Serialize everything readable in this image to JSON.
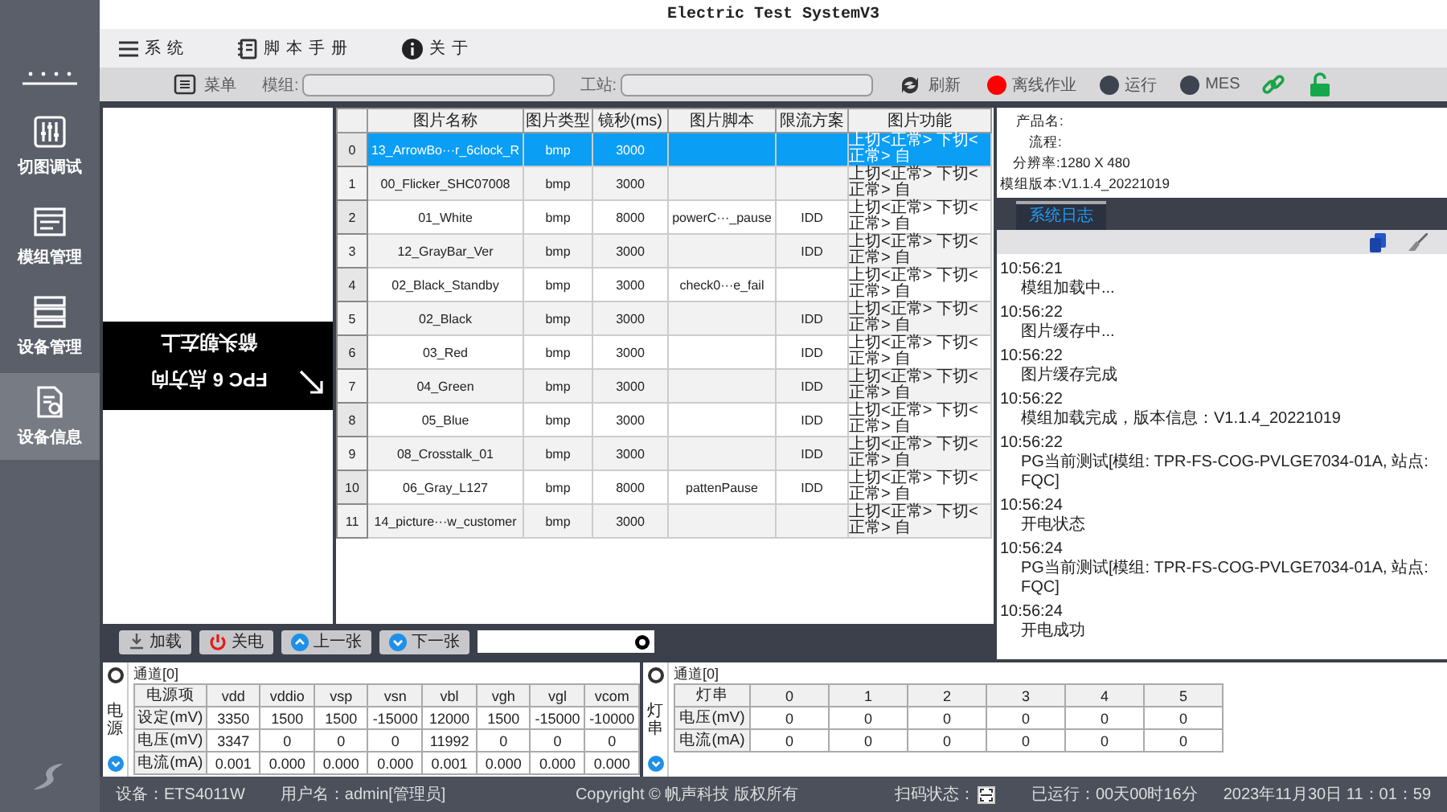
{
  "sidebar": {
    "items": [
      {
        "label": "切图调试",
        "selected": false
      },
      {
        "label": "模组管理",
        "selected": false
      },
      {
        "label": "设备管理",
        "selected": false
      },
      {
        "label": "设备信息",
        "selected": true
      }
    ]
  },
  "window": {
    "title": "Electric Test SystemV3"
  },
  "menu": [
    "系统",
    "脚本手册",
    "关于"
  ],
  "toolbar": {
    "menu_button": "菜单",
    "module_label": "模组:",
    "station_label": "工站:",
    "refresh": "刷新",
    "statuses": [
      {
        "label": "离线作业",
        "color": "#ff0000"
      },
      {
        "label": "运行",
        "color": "#3d4450"
      },
      {
        "label": "MES",
        "color": "#3d4450"
      }
    ]
  },
  "preview": {
    "lines": [
      "箭头朝左上",
      "FPC 6 点方向"
    ]
  },
  "table": {
    "columns": [
      "图片名称",
      "图片类型",
      "镜秒(ms)",
      "图片脚本",
      "限流方案",
      "图片功能"
    ],
    "rows": [
      {
        "index": "0",
        "cells": [
          "13_ArrowBo···r_6clock_R",
          "bmp",
          "3000",
          "",
          "",
          "上切<正常> 下切<正常> 自"
        ],
        "selected": true
      },
      {
        "index": "1",
        "cells": [
          "00_Flicker_SHC07008",
          "bmp",
          "3000",
          "",
          "",
          "上切<正常> 下切<正常> 自"
        ],
        "selected": false
      },
      {
        "index": "2",
        "cells": [
          "01_White",
          "bmp",
          "8000",
          "powerC···_pause",
          "IDD",
          "上切<正常> 下切<正常> 自"
        ],
        "selected": false
      },
      {
        "index": "3",
        "cells": [
          "12_GrayBar_Ver",
          "bmp",
          "3000",
          "",
          "IDD",
          "上切<正常> 下切<正常> 自"
        ],
        "selected": false
      },
      {
        "index": "4",
        "cells": [
          "02_Black_Standby",
          "bmp",
          "3000",
          "check0···e_fail",
          "",
          "上切<正常> 下切<正常> 自"
        ],
        "selected": false
      },
      {
        "index": "5",
        "cells": [
          "02_Black",
          "bmp",
          "3000",
          "",
          "IDD",
          "上切<正常> 下切<正常> 自"
        ],
        "selected": false
      },
      {
        "index": "6",
        "cells": [
          "03_Red",
          "bmp",
          "3000",
          "",
          "IDD",
          "上切<正常> 下切<正常> 自"
        ],
        "selected": false
      },
      {
        "index": "7",
        "cells": [
          "04_Green",
          "bmp",
          "3000",
          "",
          "IDD",
          "上切<正常> 下切<正常> 自"
        ],
        "selected": false
      },
      {
        "index": "8",
        "cells": [
          "05_Blue",
          "bmp",
          "3000",
          "",
          "IDD",
          "上切<正常> 下切<正常> 自"
        ],
        "selected": false
      },
      {
        "index": "9",
        "cells": [
          "08_Crosstalk_01",
          "bmp",
          "3000",
          "",
          "IDD",
          "上切<正常> 下切<正常> 自"
        ],
        "selected": false
      },
      {
        "index": "10",
        "cells": [
          "06_Gray_L127",
          "bmp",
          "8000",
          "pattenPause",
          "IDD",
          "上切<正常> 下切<正常> 自"
        ],
        "selected": false
      },
      {
        "index": "11",
        "cells": [
          "14_picture···w_customer",
          "bmp",
          "3000",
          "",
          "",
          "上切<正常> 下切<正常> 自"
        ],
        "selected": false
      }
    ]
  },
  "controls": {
    "buttons": [
      {
        "label": "加载",
        "kind": "load"
      },
      {
        "label": "关电",
        "kind": "power"
      },
      {
        "label": "上一张",
        "kind": "up"
      },
      {
        "label": "下一张",
        "kind": "down"
      }
    ]
  },
  "info": [
    "产品名:",
    "流程:",
    "分辨率:1280 X 480",
    "模组版本:V1.1.4_20221019"
  ],
  "log": {
    "tabs": [
      {
        "label": "系统日志",
        "selected": true
      }
    ],
    "entries": [
      {
        "time": "10:56:21",
        "message": "模组加载中..."
      },
      {
        "time": "10:56:22",
        "message": "图片缓存中..."
      },
      {
        "time": "10:56:22",
        "message": "图片缓存完成"
      },
      {
        "time": "10:56:22",
        "message": "模组加载完成，版本信息：V1.1.4_20221019"
      },
      {
        "time": "10:56:22",
        "message": "PG当前测试[模组: TPR-FS-COG-PVLGE7034-01A, 站点: FQC]"
      },
      {
        "time": "10:56:24",
        "message": "开电状态"
      },
      {
        "time": "10:56:24",
        "message": "PG当前测试[模组: TPR-FS-COG-PVLGE7034-01A, 站点: FQC]"
      },
      {
        "time": "10:56:24",
        "message": "开电成功"
      }
    ]
  },
  "power": {
    "label": "电源",
    "channel": "通道[0]",
    "columns": [
      "电源项",
      "vdd",
      "vddio",
      "vsp",
      "vsn",
      "vbl",
      "vgh",
      "vgl",
      "vcom"
    ],
    "rows": [
      [
        "设定(mV)",
        "3350",
        "1500",
        "1500",
        "-15000",
        "12000",
        "1500",
        "-15000",
        "-10000"
      ],
      [
        "电压(mV)",
        "3347",
        "0",
        "0",
        "0",
        "11992",
        "0",
        "0",
        "0"
      ],
      [
        "电流(mA)",
        "0.001",
        "0.000",
        "0.000",
        "0.000",
        "0.001",
        "0.000",
        "0.000",
        "0.000"
      ]
    ]
  },
  "light": {
    "label": "灯串",
    "channel": "通道[0]",
    "columns": [
      "灯串",
      "0",
      "1",
      "2",
      "3",
      "4",
      "5"
    ],
    "rows": [
      [
        "电压(mV)",
        "0",
        "0",
        "0",
        "0",
        "0",
        "0"
      ],
      [
        "电流(mA)",
        "0",
        "0",
        "0",
        "0",
        "0",
        "0"
      ]
    ]
  },
  "status_bar": {
    "device": "设备：ETS4011W",
    "user": "用户名：admin[管理员]",
    "copyright": "Copyright © 帆声科技 版权所有",
    "scan": "扫码状态：",
    "uptime": "已运行：00天00时16分",
    "datetime": "2023年11月30日 11：01：59"
  }
}
